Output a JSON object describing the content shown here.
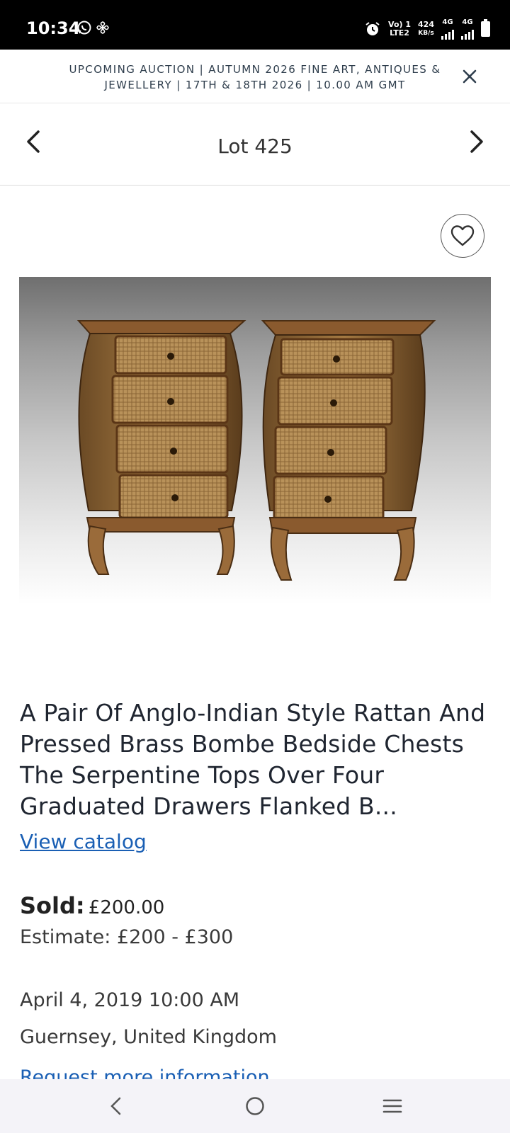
{
  "status_bar": {
    "time": "10:34",
    "net_line1": "Vo) 1",
    "net_line2": "LTE2",
    "speed_value": "424",
    "speed_unit": "KB/s",
    "sim1_type": "4G",
    "sim2_type": "4G"
  },
  "banner": {
    "text": "UPCOMING AUCTION | AUTUMN 2026 FINE ART, ANTIQUES & JEWELLERY | 17TH & 18TH 2026 | 10.00 AM GMT"
  },
  "lot_nav": {
    "title": "Lot 425"
  },
  "lot": {
    "title": "A Pair Of Anglo-Indian Style Rattan And Pressed Brass Bombe Bedside Chests The Serpentine Tops Over Four Graduated Drawers Flanked B...",
    "view_catalog": "View catalog",
    "sold_label": "Sold:",
    "sold_value": "£200.00",
    "estimate": "Estimate: £200 - £300",
    "date": "April 4, 2019 10:00 AM",
    "location": "Guernsey, United Kingdom",
    "request_info": "Request more information"
  },
  "colors": {
    "link": "#1a5fb4",
    "text_dark": "#1f2530",
    "banner_text": "#2e3d4c"
  },
  "icons": [
    "whatsapp-icon",
    "fan-icon",
    "alarm-icon",
    "signal-icon",
    "battery-icon",
    "close-icon",
    "chevron-left-icon",
    "chevron-right-icon",
    "heart-icon",
    "back-icon",
    "home-icon",
    "recents-icon"
  ]
}
